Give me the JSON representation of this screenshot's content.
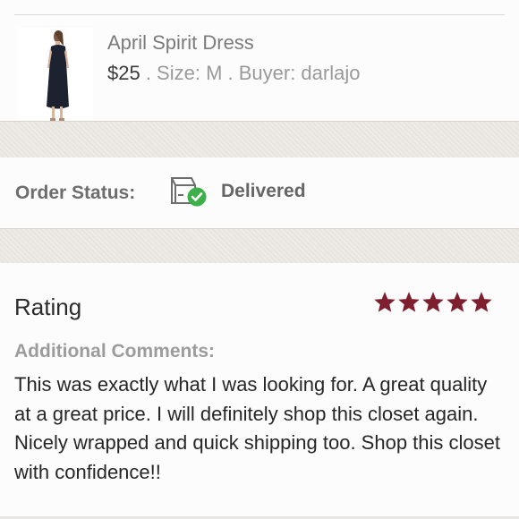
{
  "listing": {
    "title": "April Spirit Dress",
    "price": "$25",
    "meta": " . Size: M . Buyer: darlajo"
  },
  "order_status": {
    "label": "Order Status:",
    "value": "Delivered",
    "icon": "package-delivered-icon",
    "check_color": "#3eb04b"
  },
  "rating": {
    "title": "Rating",
    "stars": 5,
    "max_stars": 5,
    "star_color": "#7d1f2f"
  },
  "comments": {
    "label": "Additional Comments:",
    "text": "This was exactly what I was looking for. A great quality at a great price. I will definitely shop this closet again. Nicely wrapped and quick shipping too. Shop this closet with confidence!!"
  }
}
